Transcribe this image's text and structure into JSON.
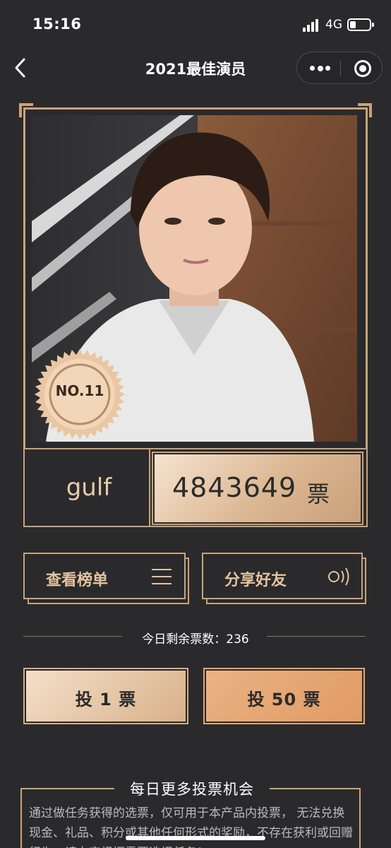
{
  "status_bar": {
    "time": "15:16",
    "network": "4G"
  },
  "nav": {
    "title": "2021最佳演员"
  },
  "candidate": {
    "rank": "NO.11",
    "name": "gulf",
    "votes": "4843649",
    "votes_unit": "票"
  },
  "actions": {
    "view_ranking": "查看榜单",
    "share_friends": "分享好友"
  },
  "remaining": {
    "text": "今日剩余票数：236"
  },
  "vote_buttons": {
    "vote_one": "投 1 票",
    "vote_fifty": "投 50 票"
  },
  "more_chances": {
    "title": "每日更多投票机会",
    "text": "通过做任务获得的选票，仅可用于本产品内投票， 无法兑换现金、礼品、积分或其他任何形式的奖励，不存在获利或回赠行为，请力定根据需要选择任务！"
  },
  "colors": {
    "gold": "#c9a37a",
    "background": "#2a2a2c",
    "accent_orange": "#e09b63"
  }
}
